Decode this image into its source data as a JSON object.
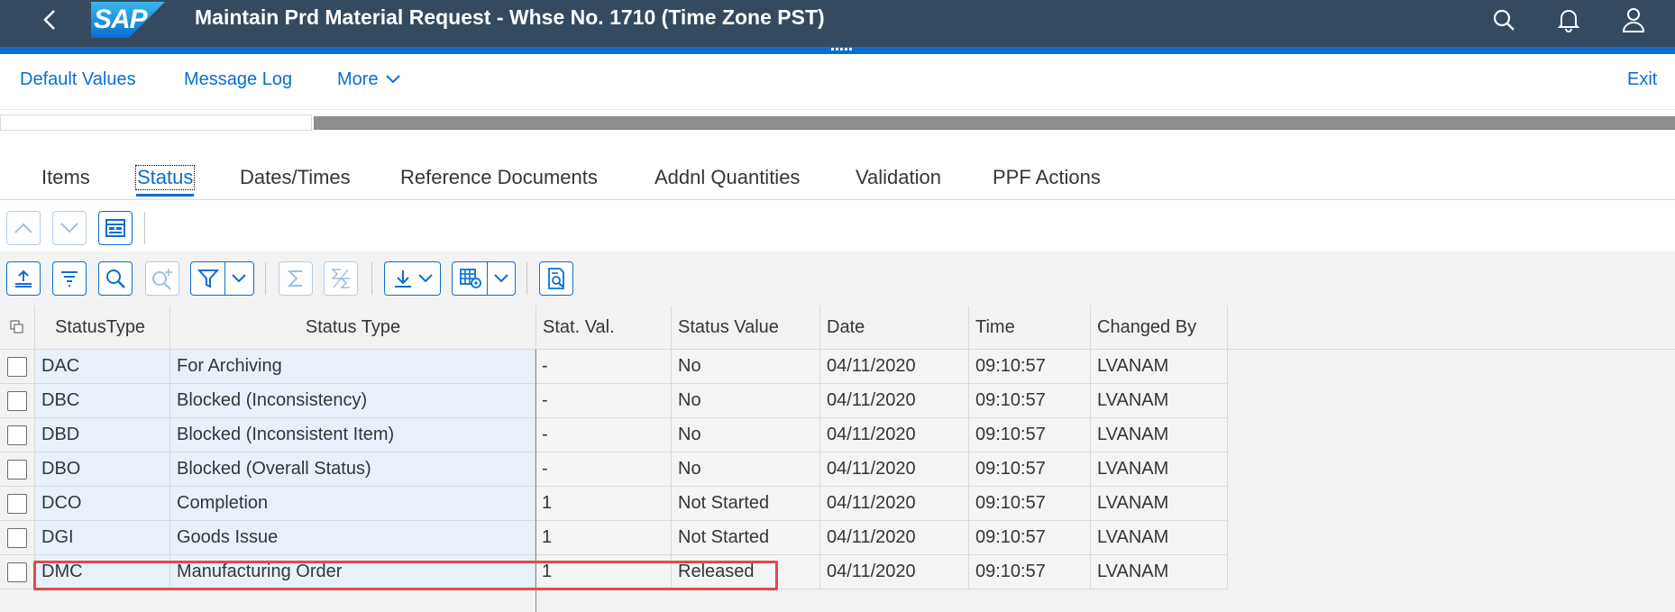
{
  "shell": {
    "logo_text": "SAP",
    "title": "Maintain Prd Material Request - Whse No. 1710 (Time Zone PST)",
    "icons": [
      "back-icon",
      "search-icon",
      "bell-icon",
      "user-icon"
    ]
  },
  "toolbar": {
    "default_values": "Default Values",
    "message_log": "Message Log",
    "more": "More",
    "exit": "Exit"
  },
  "tabs": [
    {
      "label": "Items"
    },
    {
      "label": "Status",
      "active": true
    },
    {
      "label": "Dates/Times"
    },
    {
      "label": "Reference Documents"
    },
    {
      "label": "Addnl Quantities"
    },
    {
      "label": "Validation"
    },
    {
      "label": "PPF Actions"
    }
  ],
  "table": {
    "columns": [
      "StatusType",
      "Status Type",
      "Stat. Val.",
      "Status Value",
      "Date",
      "Time",
      "Changed By"
    ],
    "rows": [
      [
        "DAC",
        "For Archiving",
        "-",
        "No",
        "04/11/2020",
        "09:10:57",
        "LVANAM"
      ],
      [
        "DBC",
        "Blocked (Inconsistency)",
        "-",
        "No",
        "04/11/2020",
        "09:10:57",
        "LVANAM"
      ],
      [
        "DBD",
        "Blocked (Inconsistent Item)",
        "-",
        "No",
        "04/11/2020",
        "09:10:57",
        "LVANAM"
      ],
      [
        "DBO",
        "Blocked (Overall Status)",
        "-",
        "No",
        "04/11/2020",
        "09:10:57",
        "LVANAM"
      ],
      [
        "DCO",
        "Completion",
        "1",
        "Not Started",
        "04/11/2020",
        "09:10:57",
        "LVANAM"
      ],
      [
        "DGI",
        "Goods Issue",
        "1",
        "Not Started",
        "04/11/2020",
        "09:10:57",
        "LVANAM"
      ],
      [
        "DMC",
        "Manufacturing Order",
        "1",
        "Released",
        "04/11/2020",
        "09:10:57",
        "LVANAM"
      ]
    ]
  },
  "colors": {
    "shell": "#354a5f",
    "accent": "#0a6ed1",
    "highlight": "#e24a4a"
  }
}
